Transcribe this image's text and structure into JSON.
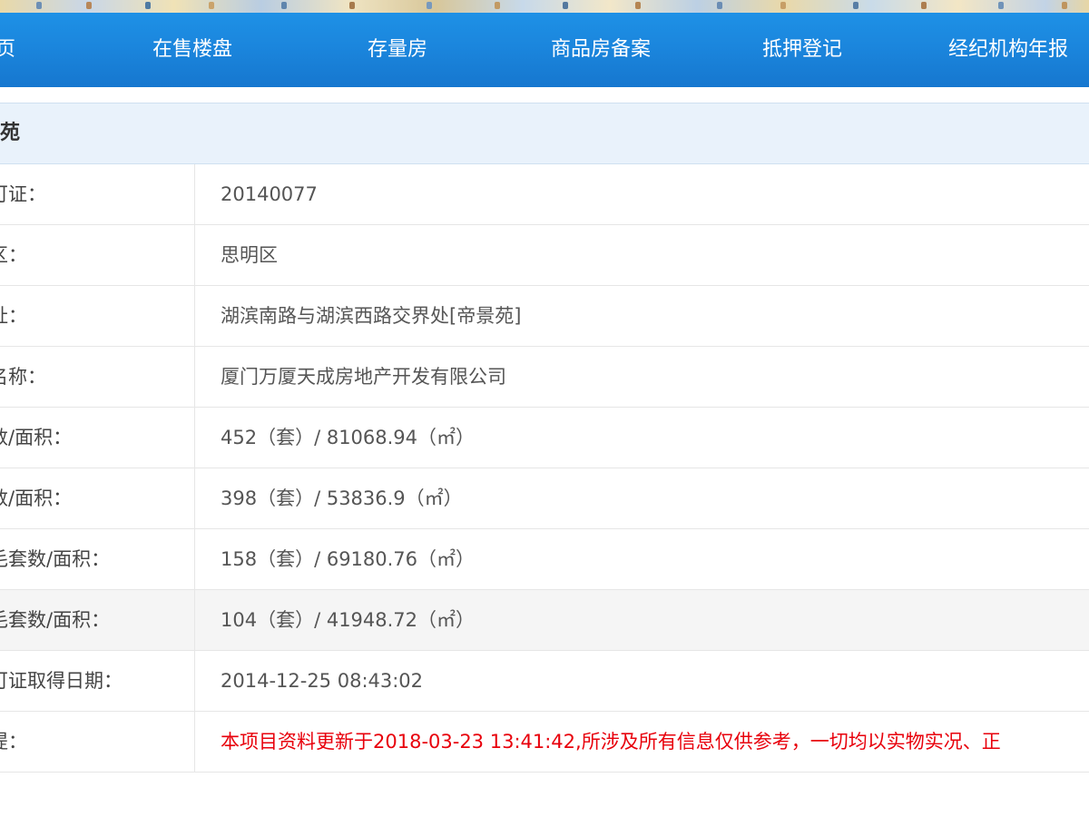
{
  "nav": {
    "items": [
      {
        "label": "页"
      },
      {
        "label": "在售楼盘"
      },
      {
        "label": "存量房"
      },
      {
        "label": "商品房备案"
      },
      {
        "label": "抵押登记"
      },
      {
        "label": "经纪机构年报"
      }
    ],
    "background_color": "#1b86dd"
  },
  "project": {
    "title": "苑"
  },
  "info_rows": [
    {
      "label": "可证：",
      "value": "20140077"
    },
    {
      "label": "区：",
      "value": "思明区"
    },
    {
      "label": "址：",
      "value": "湖滨南路与湖滨西路交界处[帝景苑]"
    },
    {
      "label": "名称：",
      "value": "厦门万厦天成房地产开发有限公司"
    },
    {
      "label": "数/面积：",
      "value": "452（套）/ 81068.94（㎡）"
    },
    {
      "label": "数/面积：",
      "value": "398（套）/ 53836.9（㎡）"
    },
    {
      "label": "毛套数/面积：",
      "value": "158（套）/ 69180.76（㎡）"
    },
    {
      "label": "毛套数/面积：",
      "value": "104（套）/ 41948.72（㎡）"
    },
    {
      "label": "可证取得日期：",
      "value": "2014-12-25 08:43:02"
    },
    {
      "label": "提：",
      "value": "本项目资料更新于2018-03-23 13:41:42,所涉及所有信息仅供参考，一切均以实物实况、正"
    }
  ],
  "colors": {
    "notice_text": "#e8000b",
    "title_bar_bg": "#e9f2fb"
  }
}
